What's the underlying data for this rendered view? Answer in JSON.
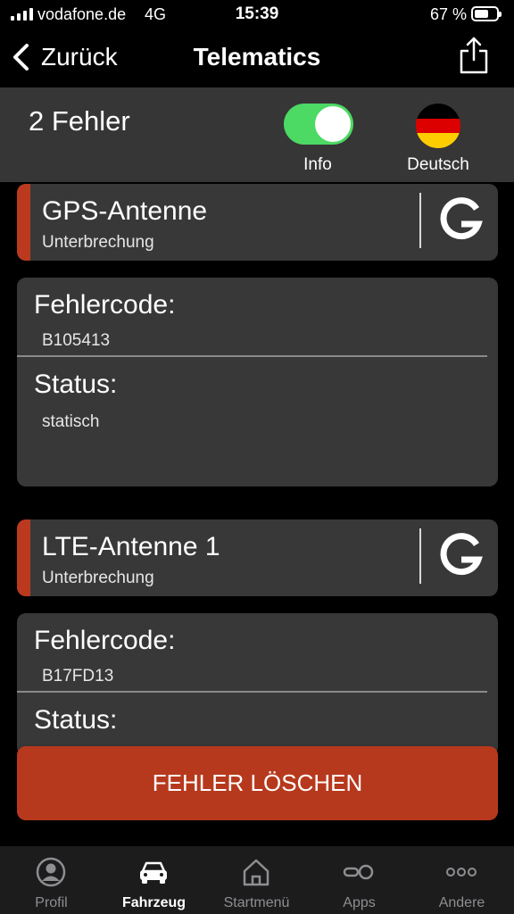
{
  "status_bar": {
    "carrier": "vodafone.de",
    "network": "4G",
    "time": "15:39",
    "battery": "67 %",
    "battery_level": 0.67
  },
  "nav": {
    "back_label": "Zurück",
    "title": "Telematics"
  },
  "header": {
    "error_count": "2 Fehler",
    "info_toggle_label": "Info",
    "info_toggle_on": true,
    "language_label": "Deutsch"
  },
  "faults": [
    {
      "name": "GPS-Antenne",
      "description": "Unterbrechung",
      "code_label": "Fehlercode:",
      "code": "B105413",
      "status_label": "Status:",
      "status": "statisch"
    },
    {
      "name": "LTE-Antenne 1",
      "description": "Unterbrechung",
      "code_label": "Fehlercode:",
      "code": "B17FD13",
      "status_label": "Status:"
    }
  ],
  "clear_button": "FEHLER LÖSCHEN",
  "tabs": [
    {
      "label": "Profil",
      "icon": "profile-icon"
    },
    {
      "label": "Fahrzeug",
      "icon": "car-icon",
      "active": true
    },
    {
      "label": "Startmenü",
      "icon": "home-icon"
    },
    {
      "label": "Apps",
      "icon": "apps-icon"
    },
    {
      "label": "Andere",
      "icon": "more-icon"
    }
  ],
  "colors": {
    "accent_red": "#b7391d",
    "toggle_green": "#4cd964",
    "panel": "#363636",
    "card": "#383838"
  }
}
